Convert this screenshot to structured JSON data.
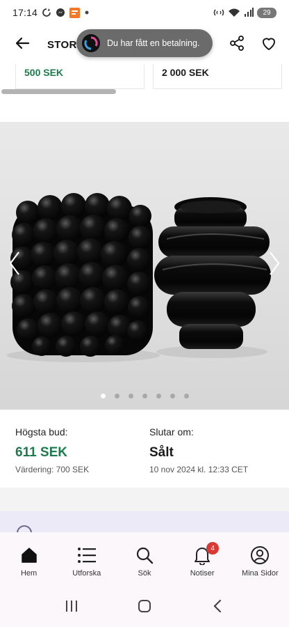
{
  "status_bar": {
    "time": "17:14",
    "battery": "29",
    "left_icons": [
      "sync-icon",
      "messenger-icon",
      "app-notification-icon",
      "dot-icon"
    ],
    "right_icons": [
      "nfc-icon",
      "wifi-icon",
      "signal-icon",
      "battery-icon"
    ]
  },
  "app_bar": {
    "title": "STOR",
    "back_icon": "arrow-left-icon",
    "share_icon": "share-icon",
    "favorite_icon": "heart-outline-icon"
  },
  "toast": {
    "text": "Du har fått en betalning."
  },
  "price_strip": {
    "items": [
      {
        "price": "500 SEK",
        "color": "#1d7a4a"
      },
      {
        "price": "2 000 SEK",
        "color": "#1a1a1a"
      }
    ]
  },
  "carousel": {
    "image_count": 7,
    "active_index": 0,
    "prev_icon": "chevron-left-icon",
    "next_icon": "chevron-right-icon"
  },
  "bid_info": {
    "highest_bid_label": "Högsta bud:",
    "highest_bid_value": "611 SEK",
    "valuation": "Värdering: 700 SEK",
    "ends_label": "Slutar om:",
    "ends_value": "Sålt",
    "ends_date": "10 nov 2024 kl. 12:33 CET"
  },
  "bottom_nav": {
    "items": [
      {
        "label": "Hem",
        "icon": "home-icon",
        "active": true
      },
      {
        "label": "Utforska",
        "icon": "list-icon",
        "active": false
      },
      {
        "label": "Sök",
        "icon": "search-icon",
        "active": false
      },
      {
        "label": "Notiser",
        "icon": "bell-icon",
        "active": false,
        "badge": "4"
      },
      {
        "label": "Mina Sidor",
        "icon": "user-circle-icon",
        "active": false
      }
    ]
  },
  "colors": {
    "accent_green": "#1d7a4a",
    "badge_red": "#d93a36",
    "nav_background": "#fbf7fa"
  }
}
